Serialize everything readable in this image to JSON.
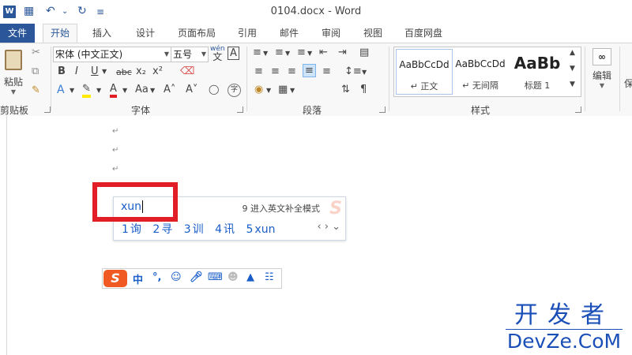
{
  "window": {
    "title": "0104.docx - Word",
    "logo_letter": "W"
  },
  "quick_access": {
    "save": "💾",
    "undo": "↶",
    "undo_dd": "⌄",
    "redo": "↻",
    "customize": "≡"
  },
  "tabs": [
    {
      "label": "文件"
    },
    {
      "label": "开始"
    },
    {
      "label": "插入"
    },
    {
      "label": "设计"
    },
    {
      "label": "页面布局"
    },
    {
      "label": "引用"
    },
    {
      "label": "邮件"
    },
    {
      "label": "审阅"
    },
    {
      "label": "视图"
    },
    {
      "label": "百度网盘"
    }
  ],
  "ribbon": {
    "clipboard": {
      "label": "剪贴板",
      "paste": "粘贴"
    },
    "font": {
      "label": "字体",
      "font_name": "宋体 (中文正文)",
      "font_size": "五号",
      "grow": "A˄",
      "shrink": "A˅",
      "case": "Aa",
      "bold": "B",
      "italic": "I",
      "underline": "U",
      "strike": "abc",
      "sub": "x₂",
      "sup": "x²",
      "color_a": "A",
      "aa": "Aa",
      "wen": "wén",
      "wen_char": "文",
      "a_box": "A",
      "a_big": "A",
      "circle": "字"
    },
    "paragraph": {
      "label": "段落"
    },
    "styles": {
      "label": "样式",
      "items": [
        {
          "sample": "AaBbCcDd",
          "name": "↵ 正文"
        },
        {
          "sample": "AaBbCcDd",
          "name": "↵ 无间隔"
        },
        {
          "sample": "AaBb",
          "name": "标题 1"
        }
      ]
    },
    "editing": {
      "label": "编辑"
    },
    "right_cut": "保"
  },
  "document": {
    "paragraph_mark": "↵"
  },
  "ime": {
    "input": "xun",
    "hint": "9 进入英文补全模式",
    "candidates": [
      {
        "num": "1",
        "text": "询"
      },
      {
        "num": "2",
        "text": "寻"
      },
      {
        "num": "3",
        "text": "训"
      },
      {
        "num": "4",
        "text": "讯"
      },
      {
        "num": "5",
        "text": "xun"
      }
    ],
    "nav": "‹  ›  ⌄"
  },
  "ime_toolbar": {
    "logo": "S",
    "lang": "中",
    "punct": "°,",
    "emoji": "☺",
    "mic": "♪",
    "keyboard": "⌨",
    "user": "☻",
    "skin": "❖",
    "apps": "☷"
  },
  "watermark": {
    "cn": "开发者",
    "en": "DevZe.CoM"
  }
}
